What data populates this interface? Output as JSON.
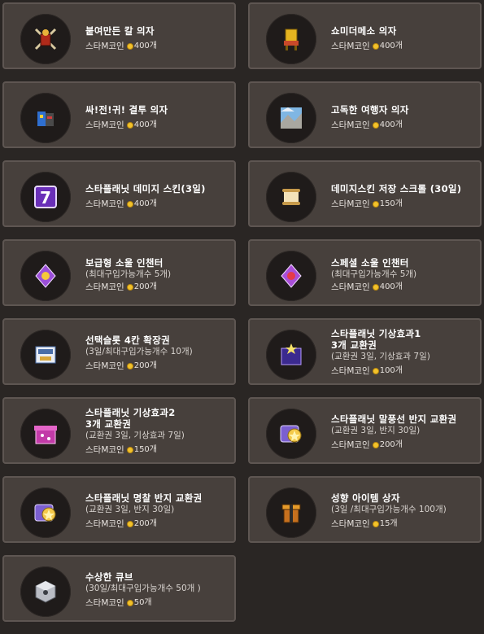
{
  "currency_label": "스타M코인",
  "items": [
    {
      "name": "붙여만든 칼 의자",
      "desc": "",
      "price": "400개",
      "icon": "sword-chair-icon"
    },
    {
      "name": "쇼미더메소 의자",
      "desc": "",
      "price": "400개",
      "icon": "gold-chair-icon"
    },
    {
      "name": "싸!전!귀! 결투 의자",
      "desc": "",
      "price": "400개",
      "icon": "duel-chair-icon"
    },
    {
      "name": "고독한 여행자 의자",
      "desc": "",
      "price": "400개",
      "icon": "traveler-chair-icon"
    },
    {
      "name": "스타플래닛 데미지 스킨(3일)",
      "desc": "",
      "price": "400개",
      "icon": "damage-skin-icon"
    },
    {
      "name": "데미지스킨 저장 스크롤 (30일)",
      "desc": "",
      "price": "150개",
      "icon": "scroll-icon"
    },
    {
      "name": "보급형 소울 인챈터",
      "desc": "(최대구입가능개수 5개)",
      "price": "200개",
      "icon": "soul-enchanter-icon"
    },
    {
      "name": "스페셜 소울 인챈터",
      "desc": "(최대구입가능개수 5개)",
      "price": "400개",
      "icon": "special-soul-enchanter-icon"
    },
    {
      "name": "선택슬롯 4칸 확장권",
      "desc": "(3일/최대구입가능개수 10개)",
      "price": "200개",
      "icon": "slot-ticket-icon"
    },
    {
      "name": "스타플래닛 기상효과1\n3개 교환권",
      "desc": "(교환권 3일, 기상효과 7일)",
      "price": "100개",
      "icon": "weather-box-purple-icon"
    },
    {
      "name": "스타플래닛 기상효과2\n3개 교환권",
      "desc": "(교환권 3일, 기상효과 7일)",
      "price": "150개",
      "icon": "weather-box-pink-icon"
    },
    {
      "name": "스타플래닛 말풍선 반지 교환권",
      "desc": "(교환권 3일, 반지 30일)",
      "price": "200개",
      "icon": "ring-ticket-icon"
    },
    {
      "name": "스타플래닛 명찰 반지 교환권",
      "desc": "(교환권 3일, 반지 30일)",
      "price": "200개",
      "icon": "nametag-ring-ticket-icon"
    },
    {
      "name": "성향 아이템 상자",
      "desc": "(3일 /최대구입가능개수 100개)",
      "price": "15개",
      "icon": "trait-box-icon"
    },
    {
      "name": "수상한 큐브",
      "desc": "(30일/최대구입가능개수 50개 )",
      "price": "50개",
      "icon": "cube-icon"
    }
  ]
}
